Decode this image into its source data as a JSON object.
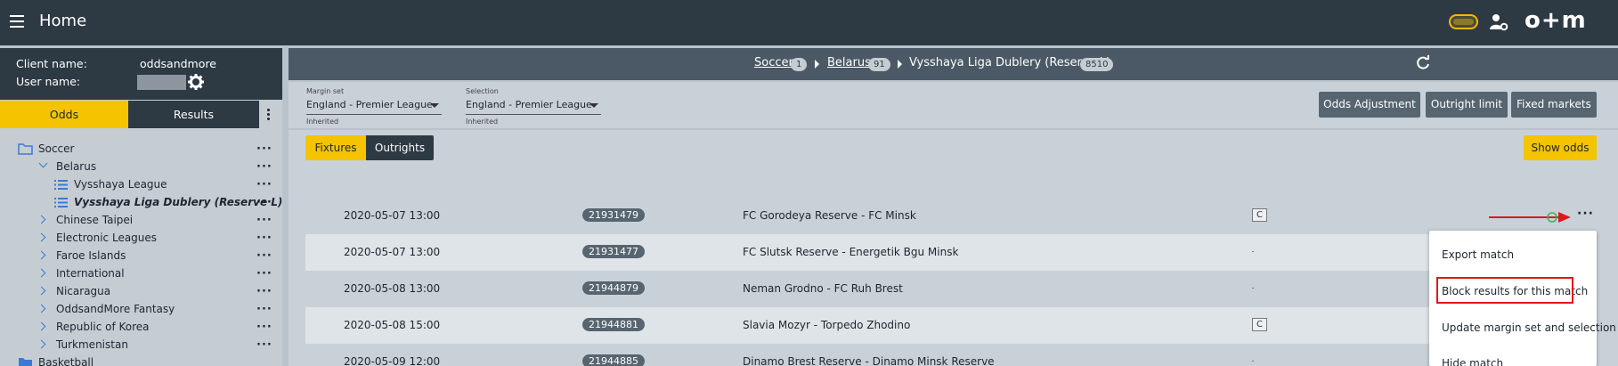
{
  "header": {
    "title": "Home",
    "logo_text": "o+m",
    "accent_color": "#f5c300",
    "bg_color": "#2d3943"
  },
  "client_info": {
    "client_label": "Client name:",
    "client_value": "oddsandmore",
    "user_label": "User name:"
  },
  "left_tabs": {
    "odds": "Odds",
    "results": "Results"
  },
  "tree": [
    {
      "label": "Soccer",
      "kind": "folder"
    },
    {
      "label": "Belarus",
      "kind": "expanded"
    },
    {
      "label": "Vysshaya League",
      "kind": "list"
    },
    {
      "label": "Vysshaya Liga Dublery (Reserve L)",
      "kind": "list-active"
    },
    {
      "label": "Chinese Taipei",
      "kind": "collapsed"
    },
    {
      "label": "Electronic Leagues",
      "kind": "collapsed"
    },
    {
      "label": "Faroe Islands",
      "kind": "collapsed"
    },
    {
      "label": "International",
      "kind": "collapsed"
    },
    {
      "label": "Nicaragua",
      "kind": "collapsed"
    },
    {
      "label": "OddsandMore Fantasy",
      "kind": "collapsed"
    },
    {
      "label": "Republic of Korea",
      "kind": "collapsed"
    },
    {
      "label": "Turkmenistan",
      "kind": "collapsed"
    },
    {
      "label": "Basketball",
      "kind": "folder"
    }
  ],
  "breadcrumb": {
    "sport": "Soccer",
    "sport_count": "1",
    "country": "Belarus",
    "country_count": "91",
    "league": "Vysshaya Liga Dublery (Reserve L)",
    "league_count": "8510"
  },
  "filters": {
    "margin_label": "Margin set",
    "margin_value": "England - Premier League",
    "margin_sub": "Inherited",
    "selection_label": "Selection",
    "selection_value": "England - Premier League",
    "selection_sub": "Inherited"
  },
  "actions": {
    "odds_adjustment": "Odds Adjustment",
    "outright_limit": "Outright limit",
    "fixed_markets": "Fixed markets",
    "fixtures": "Fixtures",
    "outrights": "Outrights",
    "show_odds": "Show odds"
  },
  "matches": [
    {
      "date": "2020-05-07 13:00",
      "id": "21931479",
      "name": "FC Gorodeya Reserve - FC Minsk",
      "flag": "C"
    },
    {
      "date": "2020-05-07 13:00",
      "id": "21931477",
      "name": "FC Slutsk Reserve - Energetik Bgu Minsk",
      "flag": ""
    },
    {
      "date": "2020-05-08 13:00",
      "id": "21944879",
      "name": "Neman Grodno - FC Ruh Brest",
      "flag": ""
    },
    {
      "date": "2020-05-08 15:00",
      "id": "21944881",
      "name": "Slavia Mozyr - Torpedo Zhodino",
      "flag": "C"
    },
    {
      "date": "2020-05-09 12:00",
      "id": "21944885",
      "name": "Dinamo Brest Reserve - Dinamo Minsk Reserve",
      "flag": ""
    }
  ],
  "context_menu": {
    "export": "Export match",
    "block": "Block results for this match",
    "update": "Update margin set and selection",
    "hide": "Hide match"
  }
}
